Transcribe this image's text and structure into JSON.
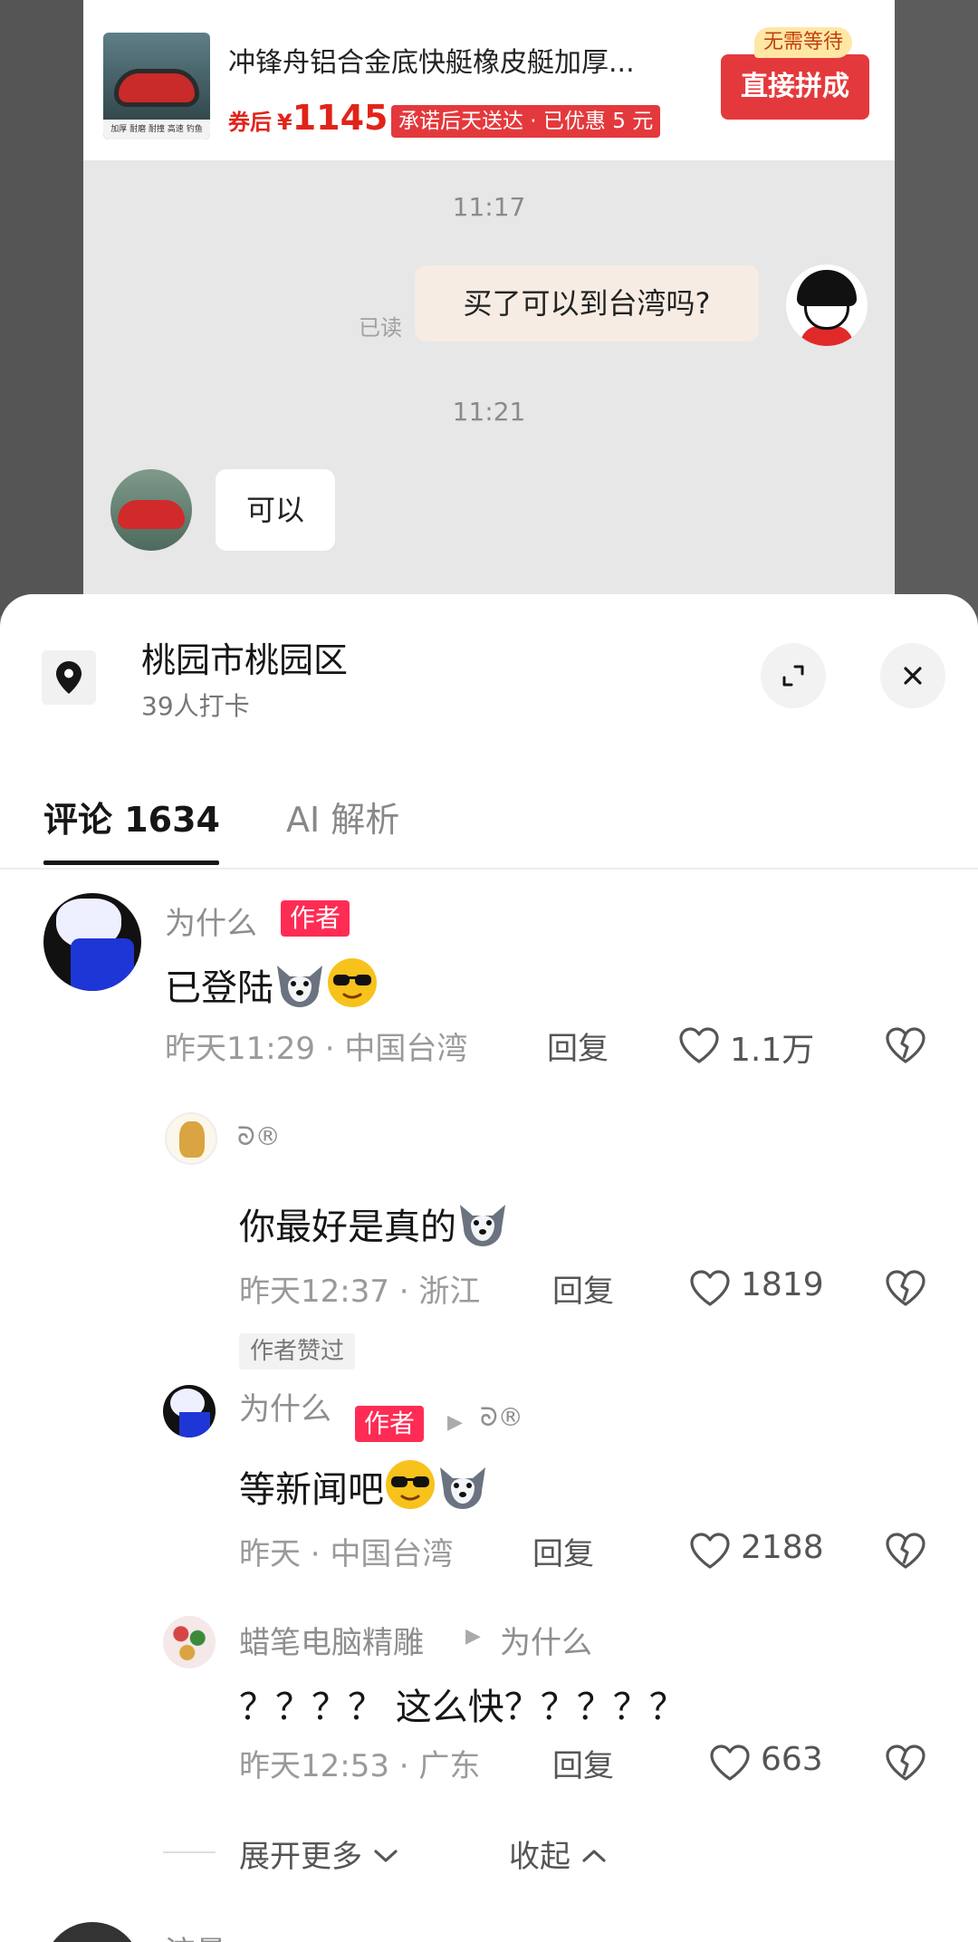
{
  "chat_background": {
    "product": {
      "title": "冲锋舟铝合金底快艇橡皮艇加厚...",
      "image_caption": "加厚 耐磨 耐撞 高速 钓鱼",
      "price_prefix": "券后",
      "price_symbol": "¥",
      "price": "1145",
      "promise": "承诺后天送达 · 已优惠 5 元",
      "no_wait_badge": "无需等待",
      "buy_button": "直接拼成"
    },
    "time1": "11:17",
    "read_status": "已读",
    "outgoing_message": "买了可以到台湾吗?",
    "time2": "11:21",
    "incoming_message": "可以"
  },
  "location": {
    "title": "桃园市桃园区",
    "subtitle": "39人打卡"
  },
  "tabs": {
    "comments": "评论 1634",
    "ai": "AI 解析"
  },
  "comments": [
    {
      "name": "为什么",
      "tag": "作者",
      "text": "已登陆",
      "time": "昨天11:29",
      "location": "中国台湾",
      "reply": "回复",
      "likes": "1.1万"
    }
  ],
  "replies": [
    {
      "name": "ᘐ®",
      "text": "你最好是真的",
      "time": "昨天12:37",
      "location": "浙江",
      "reply": "回复",
      "likes": "1819",
      "badge": "作者赞过"
    },
    {
      "name": "为什么",
      "tag": "作者",
      "reply_to": "ᘐ®",
      "text": "等新闻吧",
      "time": "昨天",
      "location": "中国台湾",
      "reply": "回复",
      "likes": "2188"
    },
    {
      "name": "蜡笔电脑精雕",
      "reply_to": "为什么",
      "text": "？？？？ 这么快？？？？？",
      "time": "昨天12:53",
      "location": "广东",
      "reply": "回复",
      "likes": "663"
    }
  ],
  "expand_more": "展开更多",
  "collapse": "收起",
  "next_comment_name": "流量"
}
